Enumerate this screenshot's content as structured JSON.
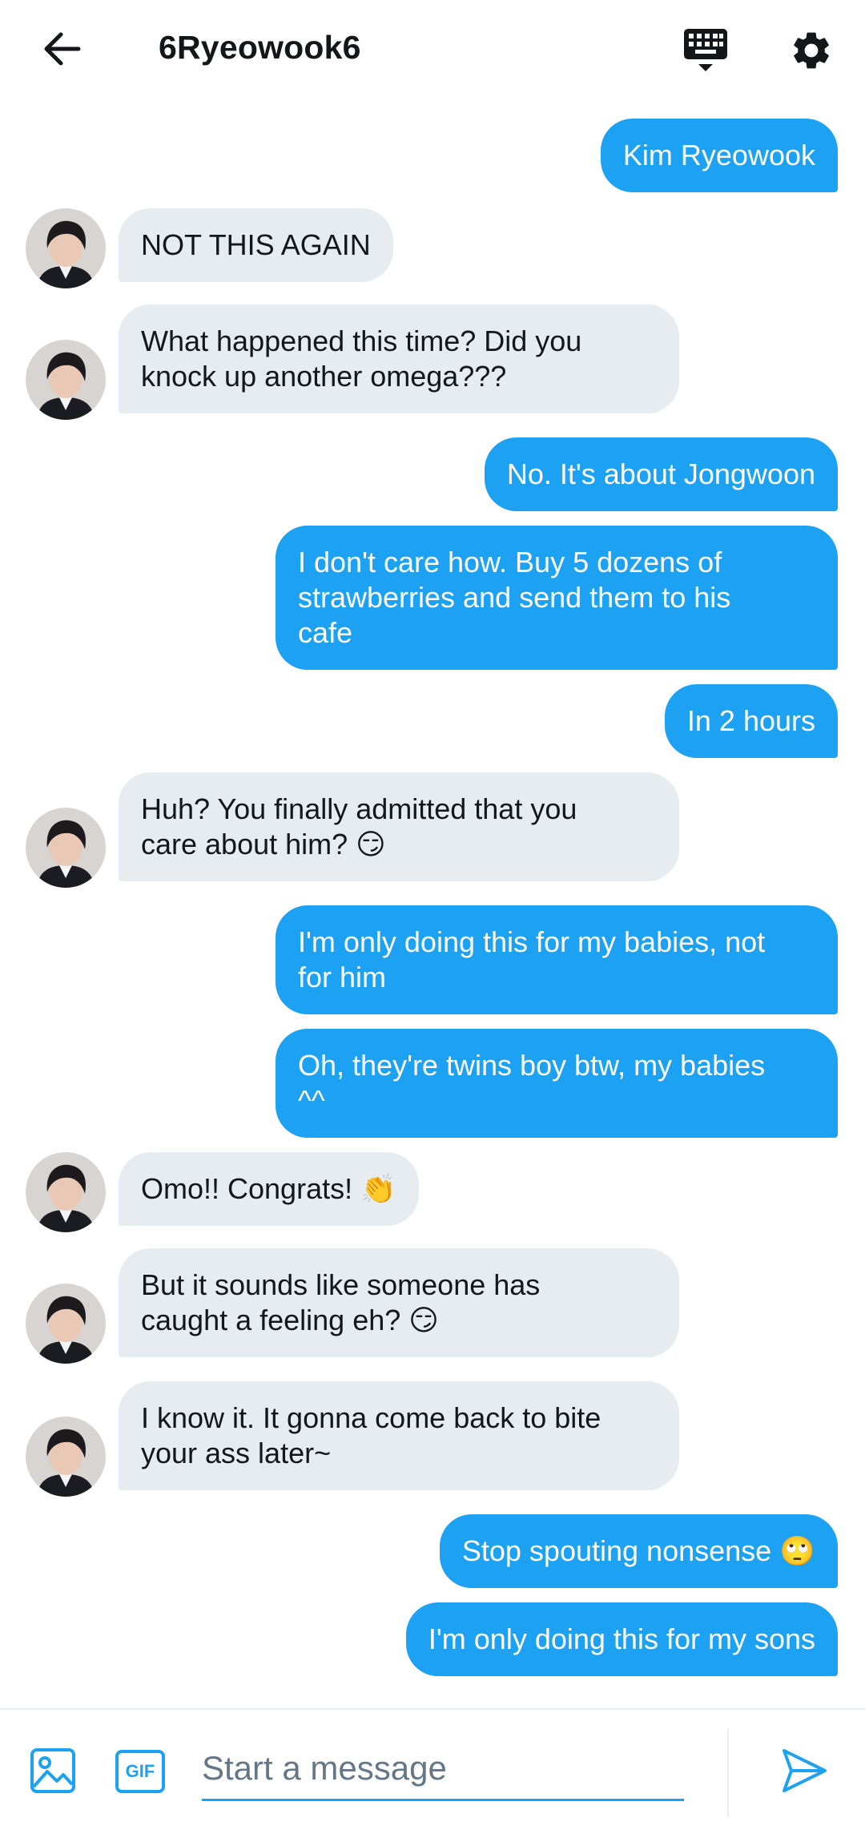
{
  "header": {
    "title": "6Ryeowook6",
    "back_icon": "arrow-left-icon",
    "keyboard_icon": "keyboard-icon",
    "settings_icon": "gear-icon"
  },
  "colors": {
    "accent": "#1da1f2",
    "received_bubble": "#e6ecf0",
    "text": "#14171a",
    "placeholder": "#657786"
  },
  "messages": [
    {
      "side": "sent",
      "text": "Kim Ryeowook"
    },
    {
      "side": "received",
      "text": "NOT THIS AGAIN"
    },
    {
      "side": "received",
      "text": "What happened this time? Did you\nknock up another omega???"
    },
    {
      "side": "sent",
      "text": "No. It's about Jongwoon"
    },
    {
      "side": "sent",
      "text": "I don't care how. Buy 5 dozens of\nstrawberries and send them to his\ncafe"
    },
    {
      "side": "sent",
      "text": "In 2 hours"
    },
    {
      "side": "received",
      "text": "Huh? You finally admitted that you\ncare about him? 😏"
    },
    {
      "side": "sent",
      "text": "I'm only doing this for my babies, not\nfor him"
    },
    {
      "side": "sent",
      "text": "Oh, they're twins boy btw, my babies\n^^"
    },
    {
      "side": "received",
      "text": "Omo!! Congrats! 👏"
    },
    {
      "side": "received",
      "text": "But it sounds like someone has\ncaught a feeling eh? 😏"
    },
    {
      "side": "received",
      "text": "I know it. It gonna come back to bite\nyour ass later~"
    },
    {
      "side": "sent",
      "text": "Stop spouting nonsense 🙄"
    },
    {
      "side": "sent",
      "text": "I'm only doing this for my sons"
    }
  ],
  "composer": {
    "placeholder": "Start a message",
    "value": "",
    "gif_label": "GIF",
    "media_icon": "image-icon",
    "send_icon": "send-icon"
  }
}
